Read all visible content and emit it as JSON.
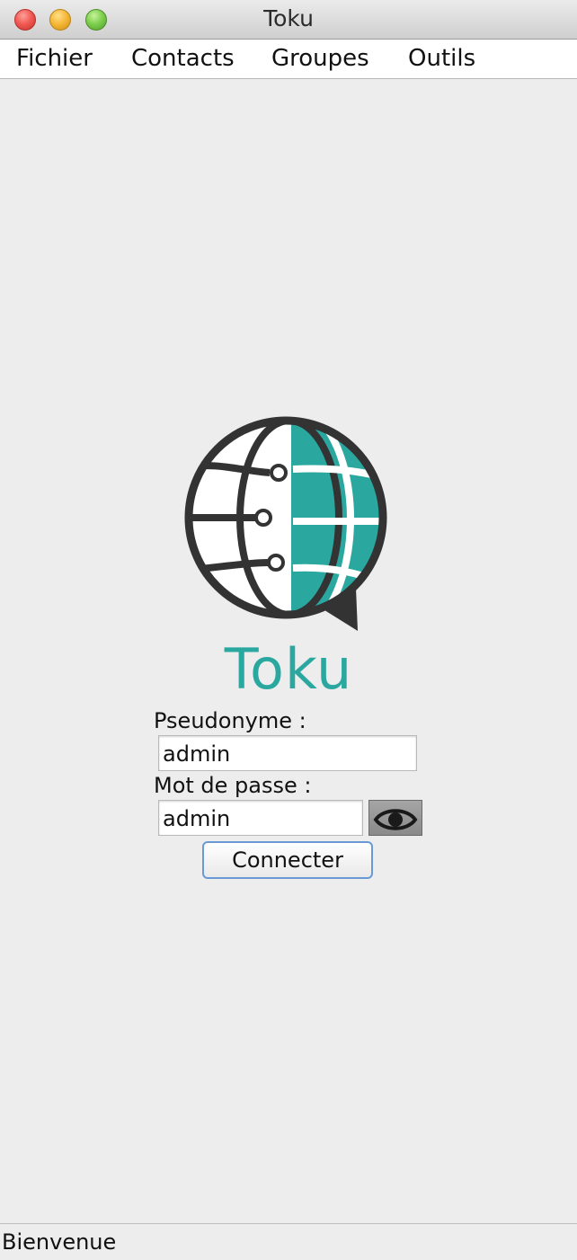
{
  "window": {
    "title": "Toku"
  },
  "menubar": {
    "items": [
      {
        "label": "Fichier"
      },
      {
        "label": "Contacts"
      },
      {
        "label": "Groupes"
      },
      {
        "label": "Outils"
      }
    ]
  },
  "logo": {
    "icon": "globe-chat-icon",
    "name": "Toku",
    "colors": {
      "teal": "#2aa8a0",
      "dark": "#333333"
    }
  },
  "login": {
    "username_label": "Pseudonyme :",
    "username_value": "admin",
    "password_label": "Mot de passe :",
    "password_value": "admin",
    "show_password_icon": "eye-icon",
    "submit_label": "Connecter"
  },
  "status": {
    "text": "Bienvenue"
  }
}
